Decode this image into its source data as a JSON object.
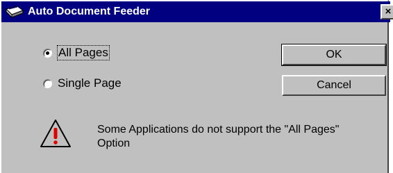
{
  "window": {
    "title": "Auto Document Feeder",
    "close_glyph": "×",
    "app_icon": "scanner-icon",
    "title_bar_color": "#000080"
  },
  "options": {
    "all_pages_label": "All Pages",
    "single_page_label": "Single Page",
    "selected": "All Pages"
  },
  "buttons": {
    "ok_label": "OK",
    "cancel_label": "Cancel"
  },
  "warning": {
    "icon": "warning-icon",
    "message": "Some Applications do not support the \"All Pages\" Option"
  }
}
